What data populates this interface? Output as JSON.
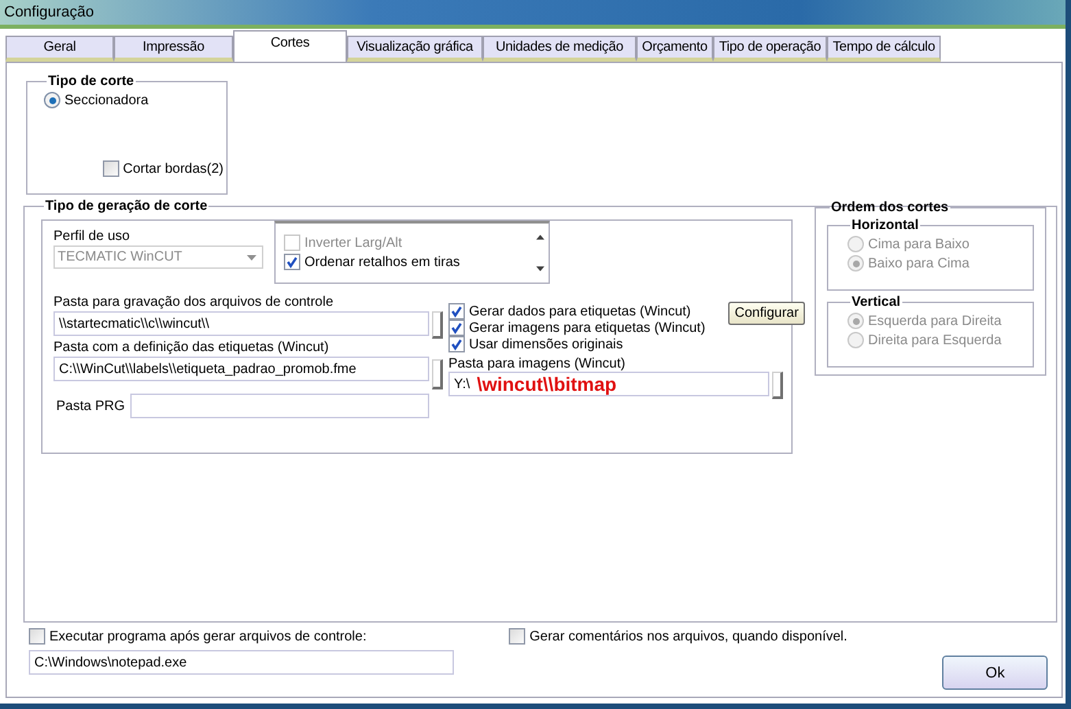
{
  "window": {
    "title": "Configuração"
  },
  "tabs": [
    {
      "label": "Geral",
      "selected": false
    },
    {
      "label": "Impressão",
      "selected": false
    },
    {
      "label": "Cortes",
      "selected": true
    },
    {
      "label": "Visualização gráfica",
      "selected": false
    },
    {
      "label": "Unidades de medição",
      "selected": false
    },
    {
      "label": "Orçamento",
      "selected": false
    },
    {
      "label": "Tipo de operação",
      "selected": false
    },
    {
      "label": "Tempo de cálculo",
      "selected": false
    }
  ],
  "tipo_de_corte": {
    "title": "Tipo de corte",
    "options": [
      {
        "label": "Seccionadora",
        "selected": true
      }
    ],
    "cortar_bordas": {
      "label": "Cortar bordas(2)",
      "checked": false
    }
  },
  "geracao": {
    "title": "Tipo de geração de corte",
    "perfil": {
      "label": "Perfil de uso",
      "value": "TECMATIC WinCUT",
      "disabled": true
    },
    "list_items": [
      {
        "label": "Inverter Larg/Alt",
        "checked": false,
        "disabled": true
      },
      {
        "label": "Ordenar retalhos em tiras",
        "checked": true,
        "disabled": false
      }
    ],
    "control_folder": {
      "label": "Pasta para gravação dos arquivos de controle",
      "value": "\\\\startecmatic\\\\c\\\\wincut\\\\"
    },
    "labels_folder": {
      "label": "Pasta com a definição das etiquetas (Wincut)",
      "value": "C:\\\\WinCut\\\\labels\\\\etiqueta_padrao_promob.fme"
    },
    "prg_folder": {
      "label": "Pasta PRG"
    },
    "options": [
      {
        "label": "Gerar dados para etiquetas (Wincut)",
        "checked": true
      },
      {
        "label": "Gerar imagens para etiquetas  (Wincut)",
        "checked": true
      },
      {
        "label": "Usar dimensões originais",
        "checked": true
      }
    ],
    "configure_button": "Configurar",
    "images_folder": {
      "label": "Pasta para imagens (Wincut)",
      "value": "Y:\\",
      "annotation": "\\wincut\\\\bitmap"
    }
  },
  "ordem": {
    "title": "Ordem dos cortes",
    "groups": [
      {
        "title": "Horizontal",
        "disabled": true,
        "options": [
          {
            "label": "Cima para Baixo",
            "selected": false
          },
          {
            "label": "Baixo para Cima",
            "selected": true
          }
        ]
      },
      {
        "title": "Vertical",
        "disabled": true,
        "options": [
          {
            "label": "Esquerda para Direita",
            "selected": true
          },
          {
            "label": "Direita para Esquerda",
            "selected": false
          }
        ]
      }
    ]
  },
  "run_after": {
    "label": "Executar programa após gerar arquivos de controle:",
    "checked": false,
    "value": "C:\\Windows\\notepad.exe"
  },
  "comments": {
    "label": "Gerar comentários nos arquivos, quando disponível.",
    "checked": false
  },
  "ok_button": "Ok"
}
